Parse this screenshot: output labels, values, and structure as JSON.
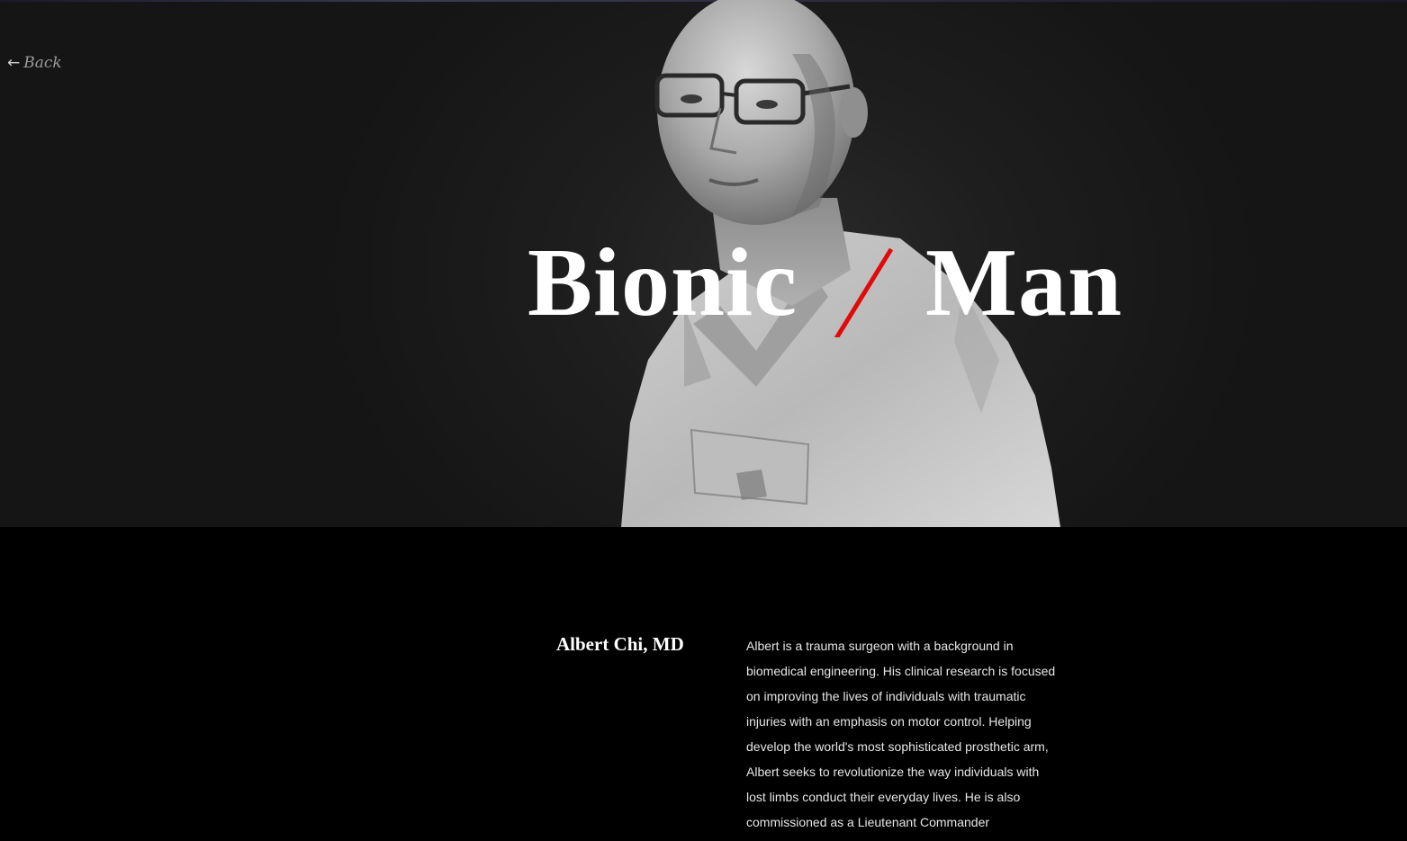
{
  "nav": {
    "back_arrow": "←",
    "back_label": "Back"
  },
  "hero": {
    "title_word_1": "Bionic",
    "title_word_2": "Man",
    "slash_color": "#e10a0a",
    "image": "black-and-white portrait of a man in scrubs and glasses"
  },
  "bio": {
    "name": "Albert Chi, MD",
    "text": "Albert is a trauma surgeon with a background in biomedical engineering. His clinical research is focused on improving the lives of individuals with traumatic injuries with an emphasis on motor control. Helping develop the world's most sophisticated prosthetic arm, Albert seeks to revolutionize the way individuals with lost limbs conduct their everyday lives. He is also commissioned as a Lieutenant Commander"
  },
  "colors": {
    "page_background": "#000000",
    "hero_background": "#1e1e1e",
    "accent_red": "#e10a0a",
    "text_white": "#ffffff"
  }
}
